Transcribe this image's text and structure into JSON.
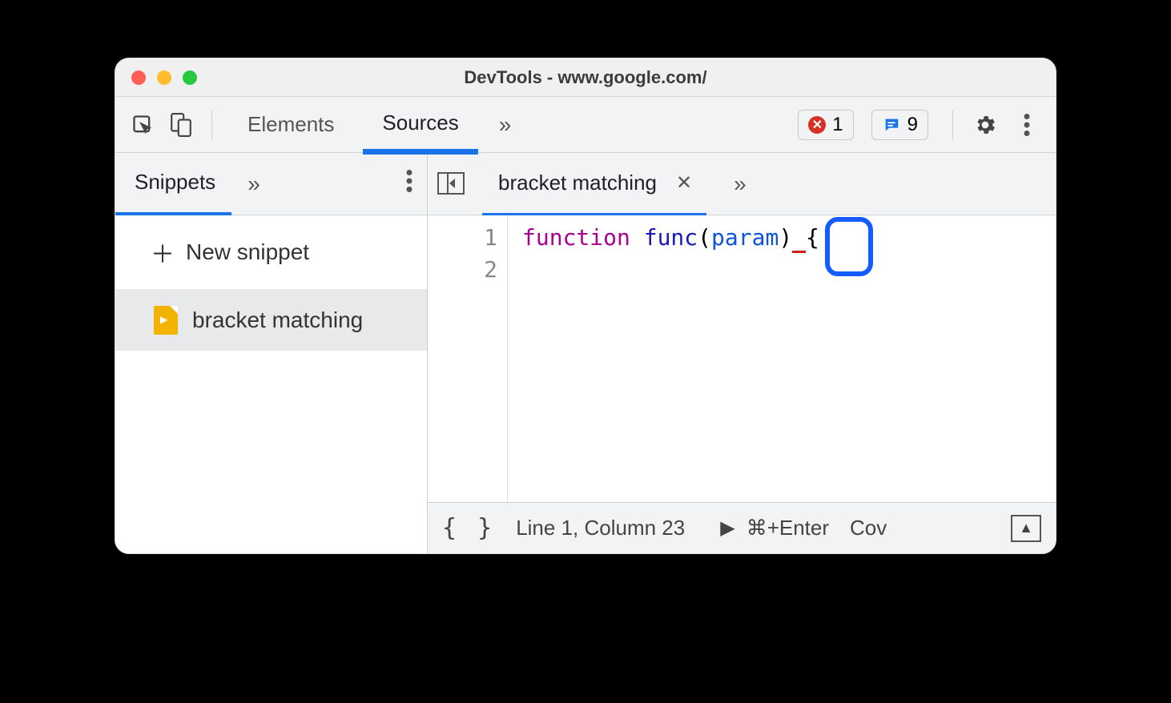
{
  "window": {
    "title": "DevTools - www.google.com/"
  },
  "toolbar": {
    "tabs": {
      "elements": "Elements",
      "sources": "Sources"
    },
    "overflow": "»",
    "errors": "1",
    "messages": "9"
  },
  "sidebar": {
    "tab": "Snippets",
    "overflow": "»",
    "new_snippet": "New snippet",
    "file": "bracket matching"
  },
  "editor": {
    "tab": "bracket matching",
    "overflow": "»",
    "lines": {
      "l1": "1",
      "l2": "2"
    },
    "code": {
      "kw": "function",
      "sp1": " ",
      "fn": "func",
      "open": "(",
      "param": "param",
      "close": ")",
      "sp2": " ",
      "brace": "{"
    }
  },
  "status": {
    "braces": "{ }",
    "pos": "Line 1, Column 23",
    "play": "▶",
    "shortcut": "⌘+Enter",
    "coverage": "Cov",
    "expand": "▲"
  }
}
